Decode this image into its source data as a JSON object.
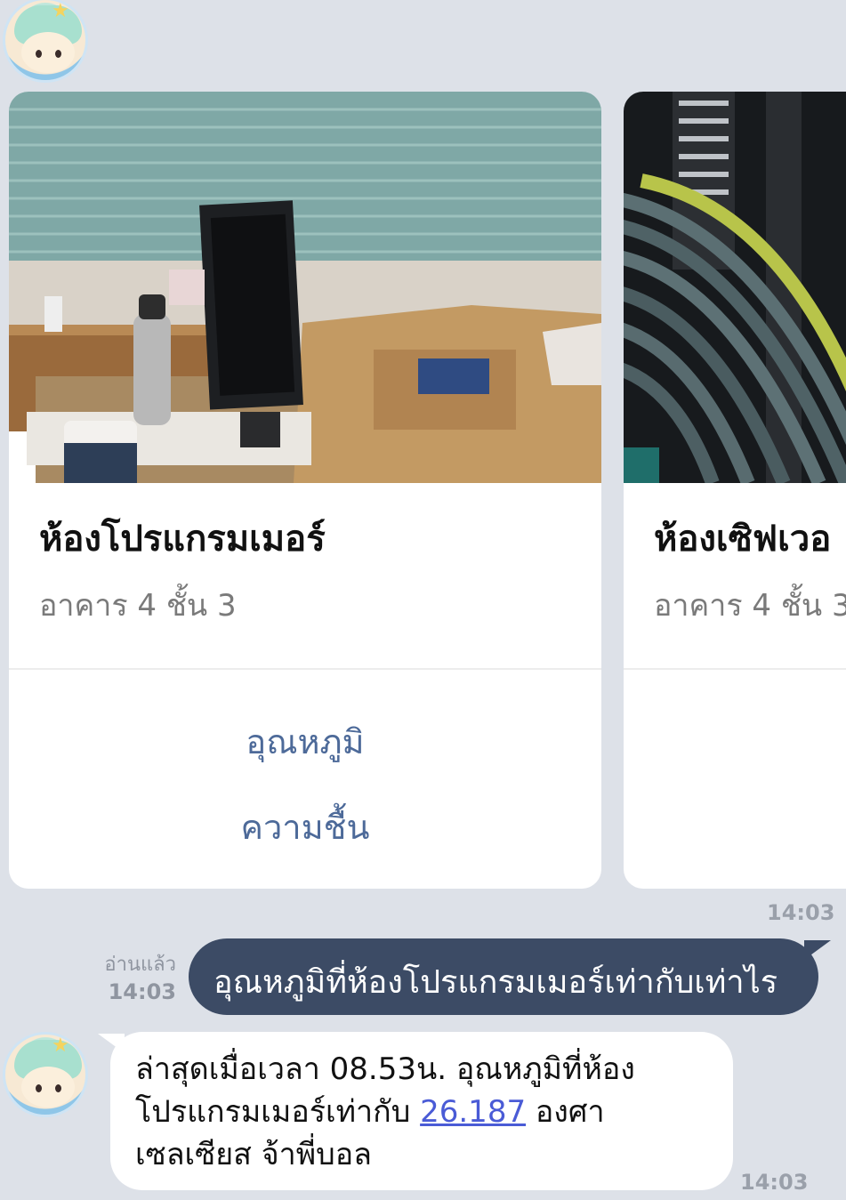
{
  "cards": [
    {
      "title": "ห้องโปรแกรมเมอร์",
      "subtitle": "อาคาร 4 ชั้น 3",
      "actions": [
        "อุณหภูมิ",
        "ความชื้น"
      ]
    },
    {
      "title": "ห้องเซิฟเวอ",
      "subtitle": "อาคาร 4 ชั้น 3"
    }
  ],
  "messages": {
    "carousel_time": "14:03",
    "user": {
      "read_label": "อ่านแล้ว",
      "time": "14:03",
      "text": "อุณหภูมิที่ห้องโปรแกรมเมอร์เท่ากับเท่าไร"
    },
    "bot": {
      "line1": "ล่าสุดเมื่อเวลา 08.53น. อุณหภูมิที่ห้อง",
      "line2_prefix": "โปรแกรมเมอร์เท่ากับ ",
      "value_link": "26.187",
      "line2_suffix": " องศา",
      "line3": "เซลเซียส จ้าพี่บอล",
      "time": "14:03"
    }
  },
  "colors": {
    "background": "#dde1e8",
    "user_bubble": "#3c4b65",
    "action_text": "#4d6a99",
    "link": "#4a5bd6"
  }
}
